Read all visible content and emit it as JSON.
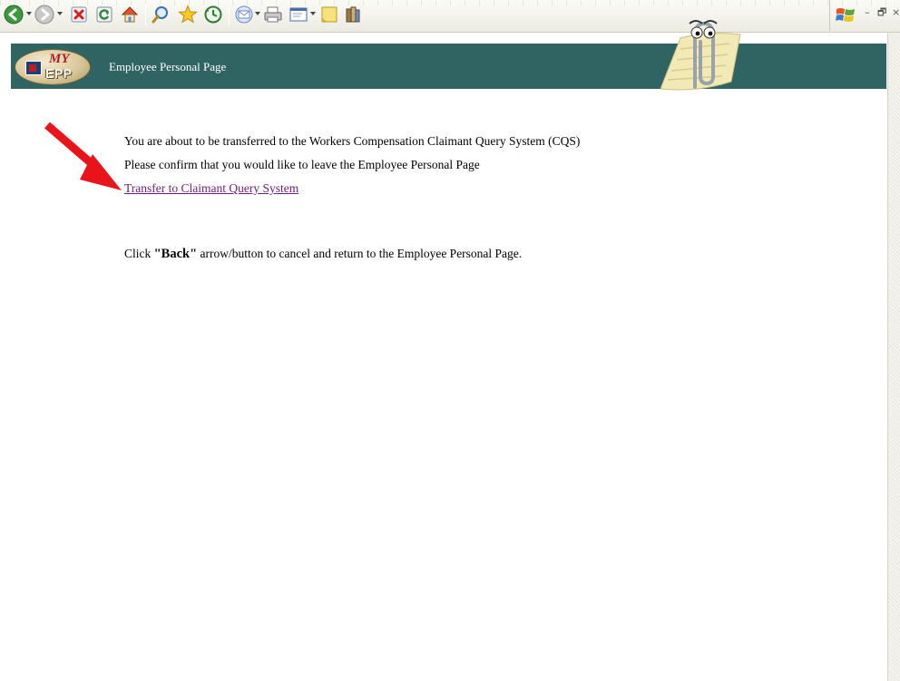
{
  "toolbar": {
    "buttons": [
      {
        "icon": "back-arrow-icon",
        "color": "#2e7d2e"
      },
      {
        "icon": "forward-arrow-icon",
        "color": "#8a8a8a"
      },
      {
        "icon": "stop-icon",
        "color": "#cc2222"
      },
      {
        "icon": "refresh-icon",
        "color": "#2e8a3a"
      },
      {
        "icon": "home-icon",
        "color": "#d98b2b"
      },
      {
        "icon": "search-icon",
        "color": "#3a6db5"
      },
      {
        "icon": "favorites-star-icon",
        "color": "#f0c419"
      },
      {
        "icon": "history-icon",
        "color": "#3a8a3a"
      },
      {
        "icon": "mail-icon",
        "color": "#6a88c8"
      },
      {
        "icon": "print-icon",
        "color": "#6b6b6b"
      },
      {
        "icon": "edit-icon",
        "color": "#4a6ea8"
      },
      {
        "icon": "discuss-note-icon",
        "color": "#f4e07a"
      },
      {
        "icon": "research-icon",
        "color": "#8a6a3a"
      }
    ],
    "window_controls": {
      "minimize": "–",
      "restore": "🗗",
      "close": "×"
    }
  },
  "header": {
    "logo": {
      "my": "MY",
      "epp": "EPP"
    },
    "title": "Employee Personal Page",
    "assistant_icon": "office-assistant-paperclip-icon"
  },
  "content": {
    "intro": "You are about to be transferred to the Workers Compensation Claimant Query System (CQS)",
    "confirm": "Please confirm that you would like to leave the Employee Personal Page",
    "link_label": "Transfer to Claimant Query System",
    "back_prefix": "Click ",
    "back_word": "\"Back\"",
    "back_suffix": " arrow/button to cancel and return to the Employee Personal Page."
  },
  "colors": {
    "banner": "#2f6463",
    "link": "#6b1f7a",
    "annotation_arrow": "#e8141a"
  }
}
